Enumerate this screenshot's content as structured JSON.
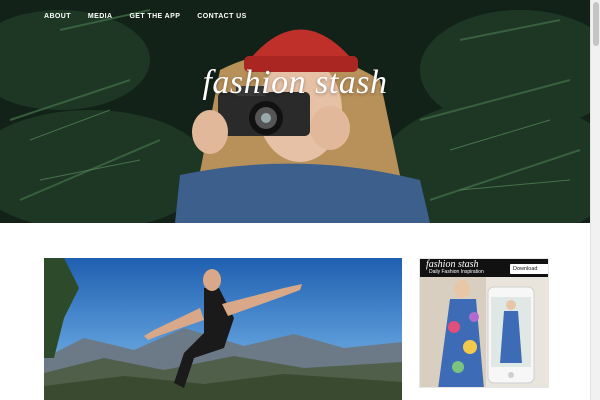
{
  "nav": {
    "items": [
      {
        "label": "ABOUT"
      },
      {
        "label": "MEDIA"
      },
      {
        "label": "GET THE APP"
      },
      {
        "label": "CONTACT US"
      }
    ]
  },
  "hero": {
    "site_title": "fashion stash"
  },
  "ad": {
    "brand": "fashion stash",
    "tagline": "Daily Fashion Inspiration",
    "button_label": "Download App"
  },
  "colors": {
    "nav_text": "#ffffff",
    "ad_header": "#111111",
    "background": "#ffffff"
  }
}
